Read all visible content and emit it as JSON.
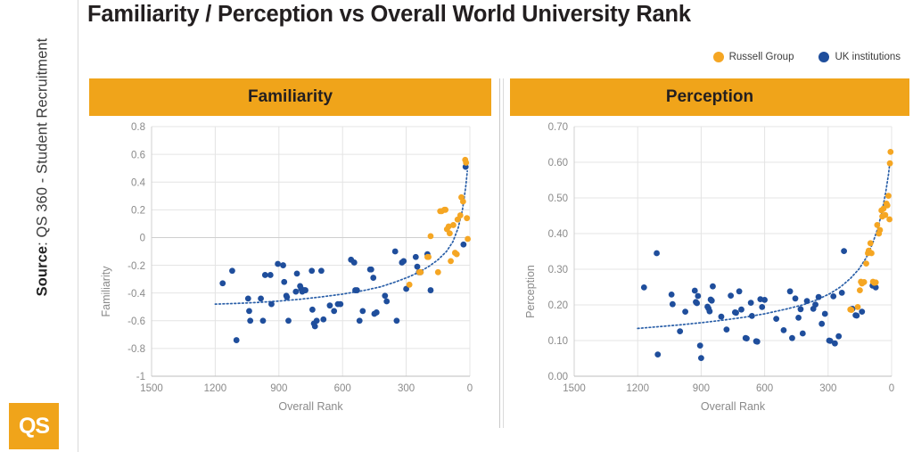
{
  "page": {
    "title": "Familiarity / Perception vs Overall World University Rank",
    "source_prefix": "Source",
    "source_text": ": QS 360 - Student Recruitment",
    "logo_text": "QS"
  },
  "colors": {
    "orange": "#f5a623",
    "orange_banner": "#f0a41a",
    "blue": "#1f4e9c",
    "trend": "#2a5fa8",
    "grid": "#e4e4e4",
    "axis_text": "#8a8a8a"
  },
  "legend": {
    "items": [
      {
        "label": "Russell Group",
        "color": "#f5a623",
        "icon": "circle-marker-icon"
      },
      {
        "label": "UK institutions",
        "color": "#1f4e9c",
        "icon": "circle-marker-icon"
      }
    ]
  },
  "panels": [
    {
      "id": "familiarity",
      "header": "Familiarity"
    },
    {
      "id": "perception",
      "header": "Perception"
    }
  ],
  "chart_data": [
    {
      "type": "scatter",
      "title": "Familiarity",
      "xlabel": "Overall Rank",
      "ylabel": "Familiarity",
      "xlim": [
        1500,
        0
      ],
      "ylim": [
        -1,
        0.8
      ],
      "xticks": [
        1500,
        1200,
        900,
        600,
        300,
        0
      ],
      "yticks": [
        0.8,
        0.6,
        0.4,
        0.2,
        0,
        -0.2,
        -0.4,
        -0.6,
        -0.8,
        -1
      ],
      "ytick_labels": [
        "0.8",
        "0.6",
        "0.4",
        "0.2",
        "0",
        "-0.2",
        "-0.4",
        "-0.6",
        "-0.8",
        "-1"
      ],
      "xtick_labels": [
        "1500",
        "1200",
        "900",
        "600",
        "300",
        "0"
      ],
      "grid": true,
      "legend_position": "top-right",
      "series": [
        {
          "name": "UK institutions",
          "color": "#1f4e9c",
          "points": [
            [
              1165,
              -0.33
            ],
            [
              1120,
              -0.24
            ],
            [
              1100,
              -0.74
            ],
            [
              1045,
              -0.44
            ],
            [
              1040,
              -0.53
            ],
            [
              1035,
              -0.6
            ],
            [
              985,
              -0.44
            ],
            [
              975,
              -0.6
            ],
            [
              965,
              -0.27
            ],
            [
              940,
              -0.27
            ],
            [
              935,
              -0.48
            ],
            [
              905,
              -0.19
            ],
            [
              880,
              -0.2
            ],
            [
              875,
              -0.32
            ],
            [
              865,
              -0.42
            ],
            [
              862,
              -0.43
            ],
            [
              855,
              -0.6
            ],
            [
              820,
              -0.39
            ],
            [
              815,
              -0.26
            ],
            [
              800,
              -0.35
            ],
            [
              795,
              -0.37
            ],
            [
              790,
              -0.39
            ],
            [
              780,
              -0.38
            ],
            [
              775,
              -0.38
            ],
            [
              745,
              -0.24
            ],
            [
              742,
              -0.52
            ],
            [
              735,
              -0.62
            ],
            [
              730,
              -0.64
            ],
            [
              722,
              -0.6
            ],
            [
              700,
              -0.24
            ],
            [
              690,
              -0.59
            ],
            [
              660,
              -0.49
            ],
            [
              640,
              -0.53
            ],
            [
              622,
              -0.48
            ],
            [
              610,
              -0.48
            ],
            [
              560,
              -0.16
            ],
            [
              545,
              -0.18
            ],
            [
              540,
              -0.38
            ],
            [
              532,
              -0.38
            ],
            [
              520,
              -0.6
            ],
            [
              505,
              -0.53
            ],
            [
              470,
              -0.23
            ],
            [
              465,
              -0.23
            ],
            [
              455,
              -0.29
            ],
            [
              450,
              -0.55
            ],
            [
              440,
              -0.54
            ],
            [
              400,
              -0.42
            ],
            [
              392,
              -0.46
            ],
            [
              352,
              -0.1
            ],
            [
              345,
              -0.6
            ],
            [
              320,
              -0.18
            ],
            [
              312,
              -0.17
            ],
            [
              300,
              -0.37
            ],
            [
              255,
              -0.14
            ],
            [
              248,
              -0.21
            ],
            [
              240,
              -0.25
            ],
            [
              232,
              -0.25
            ],
            [
              200,
              -0.12
            ],
            [
              185,
              -0.38
            ],
            [
              30,
              -0.05
            ],
            [
              20,
              0.51
            ]
          ]
        },
        {
          "name": "Russell Group",
          "color": "#f5a623",
          "points": [
            [
              285,
              -0.34
            ],
            [
              238,
              -0.25
            ],
            [
              232,
              -0.25
            ],
            [
              200,
              -0.14
            ],
            [
              195,
              -0.14
            ],
            [
              185,
              0.01
            ],
            [
              150,
              -0.25
            ],
            [
              140,
              0.19
            ],
            [
              133,
              0.19
            ],
            [
              120,
              0.2
            ],
            [
              115,
              0.2
            ],
            [
              108,
              0.06
            ],
            [
              100,
              0.08
            ],
            [
              95,
              0.03
            ],
            [
              90,
              -0.17
            ],
            [
              78,
              0.09
            ],
            [
              70,
              -0.11
            ],
            [
              62,
              -0.12
            ],
            [
              58,
              0.13
            ],
            [
              45,
              0.16
            ],
            [
              40,
              0.29
            ],
            [
              32,
              0.26
            ],
            [
              22,
              0.56
            ],
            [
              18,
              0.54
            ],
            [
              14,
              0.14
            ],
            [
              10,
              -0.01
            ]
          ]
        }
      ],
      "trend": {
        "style": "dotted",
        "color": "#2a5fa8",
        "points": [
          [
            1200,
            -0.48
          ],
          [
            1100,
            -0.475
          ],
          [
            1000,
            -0.468
          ],
          [
            900,
            -0.458
          ],
          [
            800,
            -0.445
          ],
          [
            700,
            -0.428
          ],
          [
            600,
            -0.408
          ],
          [
            500,
            -0.382
          ],
          [
            420,
            -0.355
          ],
          [
            350,
            -0.32
          ],
          [
            290,
            -0.285
          ],
          [
            240,
            -0.25
          ],
          [
            190,
            -0.205
          ],
          [
            150,
            -0.16
          ],
          [
            110,
            -0.1
          ],
          [
            80,
            -0.03
          ],
          [
            55,
            0.07
          ],
          [
            35,
            0.2
          ],
          [
            20,
            0.36
          ],
          [
            12,
            0.48
          ]
        ]
      }
    },
    {
      "type": "scatter",
      "title": "Perception",
      "xlabel": "Overall Rank",
      "ylabel": "Perception",
      "xlim": [
        1500,
        0
      ],
      "ylim": [
        0,
        0.7
      ],
      "xticks": [
        1500,
        1200,
        900,
        600,
        300,
        0
      ],
      "yticks": [
        0.7,
        0.6,
        0.5,
        0.4,
        0.3,
        0.2,
        0.1,
        0
      ],
      "ytick_labels": [
        "0.70",
        "0.60",
        "0.50",
        "0.40",
        "0.30",
        "0.20",
        "0.10",
        "0.00"
      ],
      "xtick_labels": [
        "1500",
        "1200",
        "900",
        "600",
        "300",
        "0"
      ],
      "grid": true,
      "legend_position": "top-right",
      "series": [
        {
          "name": "UK institutions",
          "color": "#1f4e9c",
          "points": [
            [
              1170,
              0.249
            ],
            [
              1110,
              0.345
            ],
            [
              1105,
              0.061
            ],
            [
              1040,
              0.229
            ],
            [
              1035,
              0.202
            ],
            [
              1000,
              0.126
            ],
            [
              975,
              0.181
            ],
            [
              930,
              0.24
            ],
            [
              925,
              0.208
            ],
            [
              920,
              0.205
            ],
            [
              915,
              0.225
            ],
            [
              905,
              0.086
            ],
            [
              900,
              0.051
            ],
            [
              870,
              0.195
            ],
            [
              865,
              0.19
            ],
            [
              860,
              0.182
            ],
            [
              855,
              0.215
            ],
            [
              850,
              0.212
            ],
            [
              845,
              0.252
            ],
            [
              805,
              0.167
            ],
            [
              780,
              0.131
            ],
            [
              760,
              0.226
            ],
            [
              740,
              0.179
            ],
            [
              735,
              0.178
            ],
            [
              720,
              0.238
            ],
            [
              710,
              0.187
            ],
            [
              690,
              0.107
            ],
            [
              685,
              0.106
            ],
            [
              665,
              0.206
            ],
            [
              660,
              0.169
            ],
            [
              640,
              0.098
            ],
            [
              635,
              0.097
            ],
            [
              620,
              0.216
            ],
            [
              612,
              0.194
            ],
            [
              600,
              0.214
            ],
            [
              545,
              0.161
            ],
            [
              510,
              0.129
            ],
            [
              480,
              0.238
            ],
            [
              470,
              0.107
            ],
            [
              455,
              0.218
            ],
            [
              440,
              0.164
            ],
            [
              430,
              0.188
            ],
            [
              420,
              0.12
            ],
            [
              400,
              0.211
            ],
            [
              370,
              0.189
            ],
            [
              360,
              0.201
            ],
            [
              345,
              0.222
            ],
            [
              330,
              0.147
            ],
            [
              315,
              0.175
            ],
            [
              295,
              0.1
            ],
            [
              290,
              0.099
            ],
            [
              275,
              0.224
            ],
            [
              268,
              0.092
            ],
            [
              250,
              0.112
            ],
            [
              235,
              0.234
            ],
            [
              225,
              0.351
            ],
            [
              190,
              0.188
            ],
            [
              185,
              0.189
            ],
            [
              170,
              0.171
            ],
            [
              165,
              0.17
            ],
            [
              140,
              0.181
            ],
            [
              90,
              0.254
            ],
            [
              75,
              0.249
            ]
          ]
        },
        {
          "name": "Russell Group",
          "color": "#f5a623",
          "points": [
            [
              195,
              0.187
            ],
            [
              190,
              0.186
            ],
            [
              160,
              0.194
            ],
            [
              150,
              0.241
            ],
            [
              145,
              0.265
            ],
            [
              140,
              0.26
            ],
            [
              130,
              0.264
            ],
            [
              120,
              0.316
            ],
            [
              112,
              0.345
            ],
            [
              108,
              0.352
            ],
            [
              100,
              0.373
            ],
            [
              95,
              0.345
            ],
            [
              88,
              0.265
            ],
            [
              82,
              0.262
            ],
            [
              75,
              0.263
            ],
            [
              68,
              0.424
            ],
            [
              60,
              0.4
            ],
            [
              55,
              0.41
            ],
            [
              48,
              0.465
            ],
            [
              44,
              0.448
            ],
            [
              38,
              0.47
            ],
            [
              30,
              0.452
            ],
            [
              24,
              0.484
            ],
            [
              20,
              0.479
            ],
            [
              15,
              0.506
            ],
            [
              10,
              0.44
            ],
            [
              8,
              0.597
            ],
            [
              5,
              0.629
            ]
          ]
        }
      ],
      "trend": {
        "style": "dotted",
        "color": "#2a5fa8",
        "points": [
          [
            1200,
            0.134
          ],
          [
            1100,
            0.139
          ],
          [
            1000,
            0.144
          ],
          [
            900,
            0.15
          ],
          [
            800,
            0.157
          ],
          [
            700,
            0.165
          ],
          [
            600,
            0.175
          ],
          [
            500,
            0.188
          ],
          [
            420,
            0.2
          ],
          [
            350,
            0.215
          ],
          [
            290,
            0.232
          ],
          [
            240,
            0.251
          ],
          [
            195,
            0.274
          ],
          [
            155,
            0.3
          ],
          [
            120,
            0.332
          ],
          [
            90,
            0.372
          ],
          [
            65,
            0.415
          ],
          [
            45,
            0.462
          ],
          [
            28,
            0.515
          ],
          [
            15,
            0.565
          ],
          [
            8,
            0.6
          ]
        ]
      }
    }
  ]
}
